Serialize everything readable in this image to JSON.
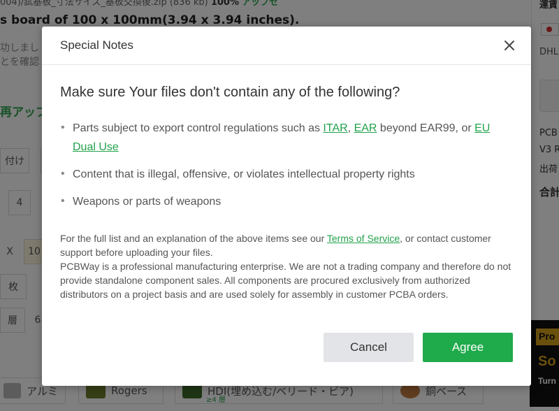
{
  "background": {
    "top_line_filename": "004)/試基板_寸法サイズ_基板交換後.zip (836 kb)",
    "top_line_percent": "100%",
    "top_line_status": "アップセ",
    "board_size": "s board of 100 x 100mm(3.94 x 3.94 inches).",
    "jp_line_1": "功しまし",
    "jp_line_2": "とを確認",
    "reupload": "再アップ",
    "fields": [
      "付け",
      "4",
      "X",
      "10",
      "枚",
      "層",
      "6"
    ],
    "right_panel": {
      "shipping": "運賃",
      "dhl": "DHL",
      "pcb": "PCB",
      "v3": "V3 R",
      "ship_jp": "出荷",
      "total": "合計"
    },
    "ad": {
      "badge": "Pro",
      "headline": "So",
      "sub": "Turn"
    },
    "categories": [
      {
        "label": "アルミ"
      },
      {
        "label": "Rogers"
      },
      {
        "label": "HDI(埋め込む/ベリード・ビア)",
        "sub": "≥4 層"
      },
      {
        "label": "銅ベース"
      }
    ]
  },
  "modal": {
    "title": "Special Notes",
    "heading": "Make sure Your files don't contain any of the following?",
    "item1": {
      "prefix": "Parts subject to export control regulations such as ",
      "link_itar": "ITAR",
      "sep": ", ",
      "link_ear": "EAR",
      "mid": " beyond EAR99, or ",
      "link_eu": "EU Dual Use"
    },
    "item2": "Content that is illegal, offensive, or violates intellectual property rights",
    "item3": "Weapons or parts of weapons",
    "fine1_prefix": "For the full list and an explanation of the above items see our ",
    "fine1_link": "Terms of Service",
    "fine1_suffix": ", or contact customer support before uploading your files.",
    "fine2": "PCBWay is a professional manufacturing enterprise. We are not a trading company and therefore do not provide standalone component sales. All components are procured exclusively from authorized distributors on a project basis and are used solely for assembly in customer PCBA orders.",
    "cancel_label": "Cancel",
    "agree_label": "Agree"
  },
  "colors": {
    "accent_green": "#1faa4b",
    "link_green": "#21a24a",
    "cancel_bg": "#e2e4e7"
  }
}
